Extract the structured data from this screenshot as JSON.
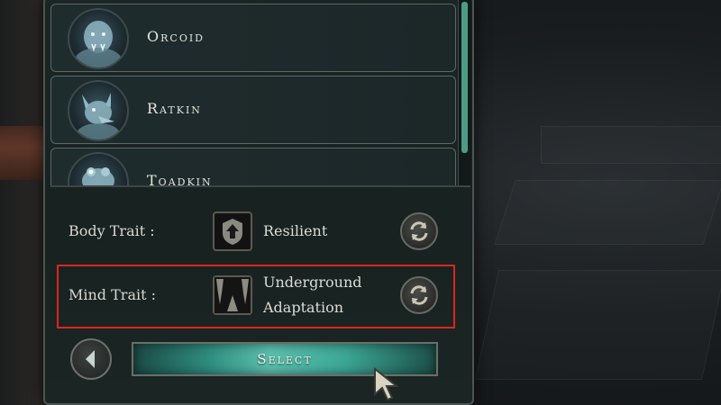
{
  "races": [
    {
      "name": "Orcoid",
      "icon": "orcoid-portrait"
    },
    {
      "name": "Ratkin",
      "icon": "ratkin-portrait"
    },
    {
      "name": "Toadkin",
      "icon": "toadkin-portrait"
    }
  ],
  "traits": {
    "body": {
      "label": "Body Trait :",
      "value": "Resilient",
      "icon": "shield-arrow-icon"
    },
    "mind": {
      "label": "Mind Trait :",
      "value_line1": "Underground",
      "value_line2": "Adaptation",
      "icon": "cave-stalactite-icon"
    }
  },
  "buttons": {
    "select_label": "Select",
    "back_icon": "left-arrow-icon",
    "reroll_icon": "reroll-icon"
  },
  "colors": {
    "accent_teal": "#4c9c86",
    "highlight_red": "#e0231f",
    "select_glow": "#5cc0ae"
  }
}
